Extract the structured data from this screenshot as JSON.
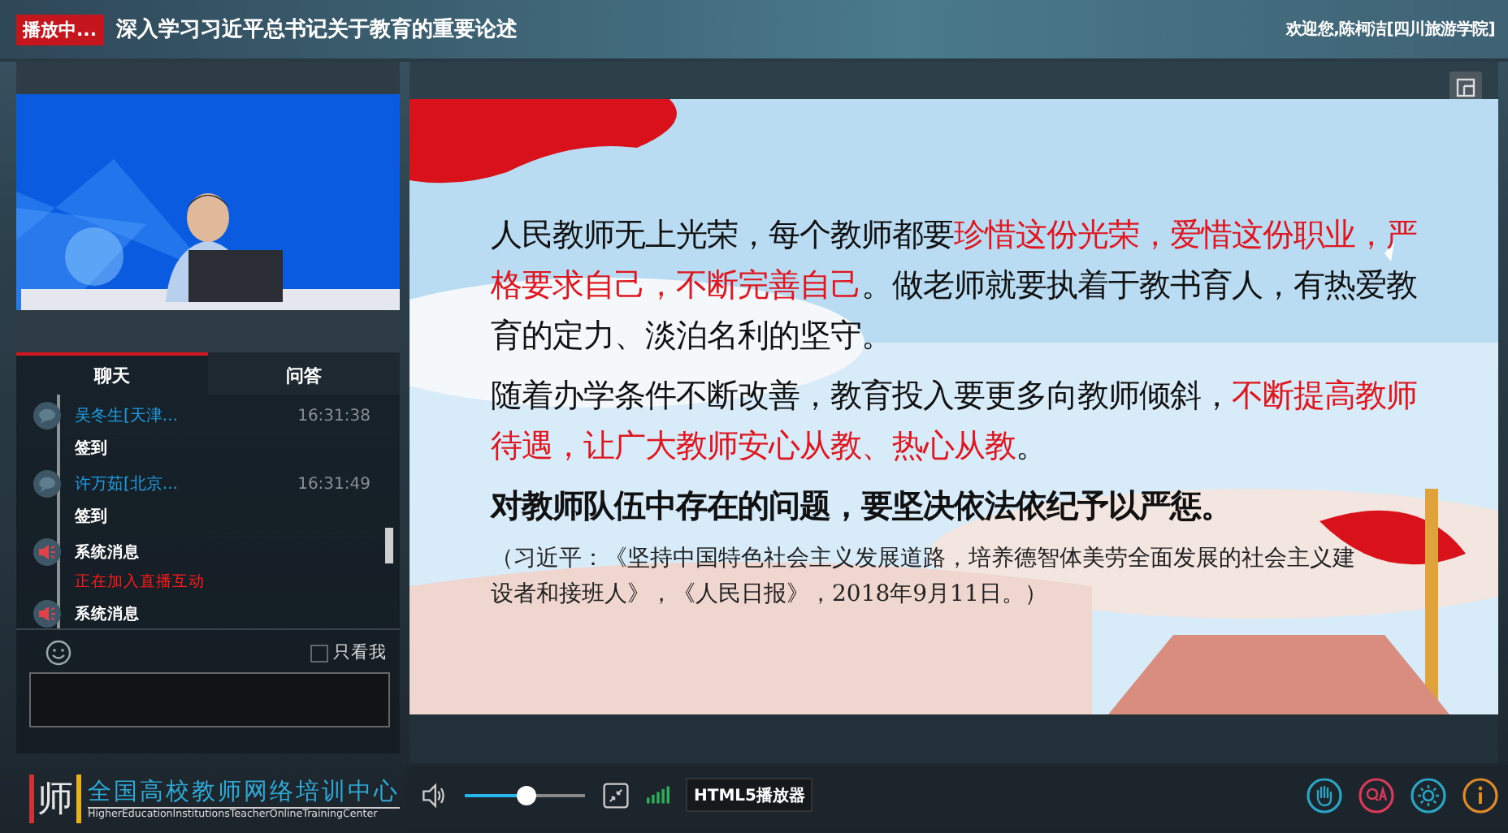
{
  "header": {
    "status_badge": "播放中...",
    "title": "深入学习习近平总书记关于教育的重要论述",
    "welcome": "欢迎您,陈柯洁[四川旅游学院]"
  },
  "tabs": [
    {
      "label": "聊天",
      "selected": true
    },
    {
      "label": "问答",
      "selected": false
    }
  ],
  "messages": [
    {
      "kind": "user",
      "name": "吴冬生[天津...",
      "time": "16:31:38",
      "text": "签到"
    },
    {
      "kind": "user",
      "name": "许万茹[北京...",
      "time": "16:31:49",
      "text": "签到"
    },
    {
      "kind": "system",
      "name": "系统消息",
      "text": "正在加入直播互动"
    },
    {
      "kind": "system",
      "name": "系统消息"
    }
  ],
  "chat_input": {
    "only_me_label": "只看我",
    "only_me_checked": false
  },
  "logo": {
    "mark": "师",
    "name": "全国高校教师网络培训中心",
    "english": "HigherEducationInstitutionsTeacherOnlineTrainingCenter"
  },
  "slide": {
    "paragraphs": [
      {
        "kind": "body",
        "segments": [
          {
            "text": "人民教师无上光荣，每个教师都要",
            "highlight": false
          },
          {
            "text": "珍惜这份光荣，爱惜这份职业，严格要求自己，不断完善自己",
            "highlight": true
          },
          {
            "text": "。做老师就要执着于教书育人，有热爱教育的定力、淡泊名利的坚守。",
            "highlight": false
          }
        ]
      },
      {
        "kind": "body",
        "segments": [
          {
            "text": "随着办学条件不断改善，教育投入要更多向教师倾斜，",
            "highlight": false
          },
          {
            "text": "不断提高教师待遇，让广大教师安心从教、热心从教",
            "highlight": true
          },
          {
            "text": "。",
            "highlight": false
          }
        ]
      },
      {
        "kind": "emphasis",
        "segments": [
          {
            "text": "对教师队伍中存在的问题，要坚决依法依纪予以严惩。",
            "highlight": false
          }
        ]
      },
      {
        "kind": "citation",
        "segments": [
          {
            "text": "（习近平：《坚持中国特色社会主义发展道路，培养德智体美劳全面发展的社会主义建设者和接班人》，《人民日报》，2018年9月11日。）",
            "highlight": false
          }
        ]
      }
    ]
  },
  "player": {
    "volume": {
      "level": 0.52
    },
    "player_label": "HTML5播放器"
  }
}
